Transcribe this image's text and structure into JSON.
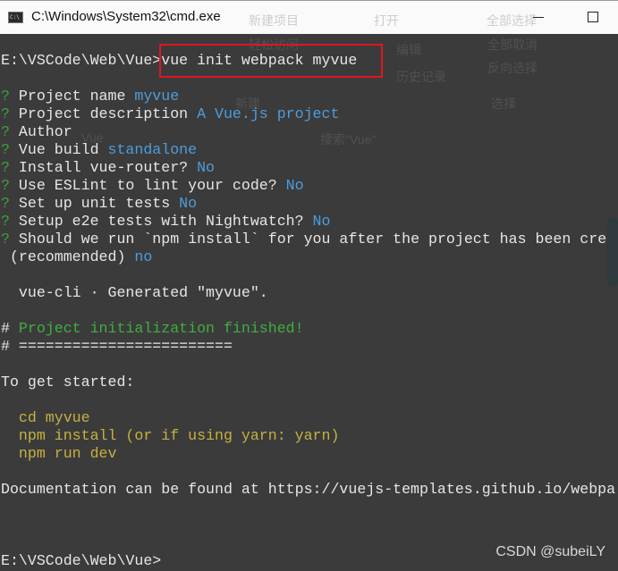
{
  "window": {
    "title": "C:\\Windows\\System32\\cmd.exe",
    "icon": "cmd-icon"
  },
  "background_ghost": [
    "新建项目",
    "轻松访问",
    "打开",
    "编辑",
    "历史记录",
    "全部选择",
    "全部取消",
    "反向选择",
    "新建",
    "选择",
    "搜索\"Vue\"",
    "Vue"
  ],
  "terminal": {
    "lines": [
      {
        "row": 0,
        "segments": [
          {
            "text": "E:\\VSCode\\Web\\Vue>",
            "c": "w"
          },
          {
            "text": "vue init webpack myvue",
            "c": "w"
          }
        ]
      },
      {
        "row": 2,
        "segments": [
          {
            "text": "?",
            "c": "q"
          },
          {
            "text": " Project name ",
            "c": "w"
          },
          {
            "text": "myvue",
            "c": "v"
          }
        ]
      },
      {
        "row": 3,
        "segments": [
          {
            "text": "?",
            "c": "q"
          },
          {
            "text": " Project description ",
            "c": "w"
          },
          {
            "text": "A Vue.js project",
            "c": "v"
          }
        ]
      },
      {
        "row": 4,
        "segments": [
          {
            "text": "?",
            "c": "q"
          },
          {
            "text": " Author",
            "c": "w"
          }
        ]
      },
      {
        "row": 5,
        "segments": [
          {
            "text": "?",
            "c": "q"
          },
          {
            "text": " Vue build ",
            "c": "w"
          },
          {
            "text": "standalone",
            "c": "v"
          }
        ]
      },
      {
        "row": 6,
        "segments": [
          {
            "text": "?",
            "c": "q"
          },
          {
            "text": " Install vue-router? ",
            "c": "w"
          },
          {
            "text": "No",
            "c": "v"
          }
        ]
      },
      {
        "row": 7,
        "segments": [
          {
            "text": "?",
            "c": "q"
          },
          {
            "text": " Use ESLint to lint your code? ",
            "c": "w"
          },
          {
            "text": "No",
            "c": "v"
          }
        ]
      },
      {
        "row": 8,
        "segments": [
          {
            "text": "?",
            "c": "q"
          },
          {
            "text": " Set up unit tests ",
            "c": "w"
          },
          {
            "text": "No",
            "c": "v"
          }
        ]
      },
      {
        "row": 9,
        "segments": [
          {
            "text": "?",
            "c": "q"
          },
          {
            "text": " Setup e2e tests with Nightwatch? ",
            "c": "w"
          },
          {
            "text": "No",
            "c": "v"
          }
        ]
      },
      {
        "row": 10,
        "segments": [
          {
            "text": "?",
            "c": "q"
          },
          {
            "text": " Should we run `npm install` for you after the project has been cre",
            "c": "w"
          }
        ]
      },
      {
        "row": 11,
        "segments": [
          {
            "text": " (recommended) ",
            "c": "w"
          },
          {
            "text": "no",
            "c": "v"
          }
        ]
      },
      {
        "row": 13,
        "segments": [
          {
            "text": "  vue-cli · Generated \"myvue\".",
            "c": "w"
          }
        ]
      },
      {
        "row": 15,
        "segments": [
          {
            "text": "#",
            "c": "w"
          },
          {
            "text": " Project initialization finished!",
            "c": "g"
          }
        ]
      },
      {
        "row": 16,
        "segments": [
          {
            "text": "# ========================",
            "c": "w"
          }
        ]
      },
      {
        "row": 18,
        "segments": [
          {
            "text": "To get started:",
            "c": "w"
          }
        ]
      },
      {
        "row": 20,
        "segments": [
          {
            "text": "  cd myvue",
            "c": "y"
          }
        ]
      },
      {
        "row": 21,
        "segments": [
          {
            "text": "  npm install (or if using yarn: yarn)",
            "c": "y"
          }
        ]
      },
      {
        "row": 22,
        "segments": [
          {
            "text": "  npm run dev",
            "c": "y"
          }
        ]
      },
      {
        "row": 24,
        "segments": [
          {
            "text": "Documentation can be found at https://vuejs-templates.github.io/webpa",
            "c": "w"
          }
        ]
      },
      {
        "row": 28,
        "segments": [
          {
            "text": "E:\\VSCode\\Web\\Vue>",
            "c": "w"
          }
        ]
      }
    ]
  },
  "watermark": "CSDN @subeiLY",
  "colors": {
    "highlight_box": "#e0161e",
    "background": "#3b3b3c",
    "prompt_mark": "#3aa03a",
    "answer": "#4c9ddb",
    "command": "#c7b13d",
    "success": "#3fae3f"
  }
}
